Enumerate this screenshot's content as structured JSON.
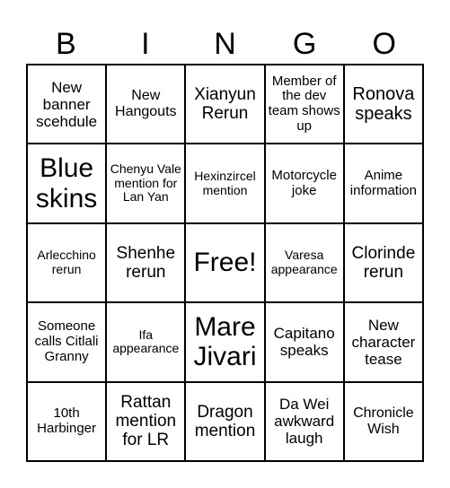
{
  "header": {
    "letters": [
      "B",
      "I",
      "N",
      "G",
      "O"
    ]
  },
  "board": {
    "cells": [
      [
        "New banner scehdule",
        "New Hangouts",
        "Xianyun Rerun",
        "Member of the dev team shows up",
        "Ronova speaks"
      ],
      [
        "Blue skins",
        "Chenyu Vale mention for Lan Yan",
        "Hexinzircel mention",
        "Motorcycle joke",
        "Anime information"
      ],
      [
        "Arlecchino rerun",
        "Shenhe rerun",
        "Free!",
        "Varesa appearance",
        "Clorinde rerun"
      ],
      [
        "Someone calls Citlali Granny",
        "Ifa appearance",
        "Mare Jivari",
        "Capitano speaks",
        "New character tease"
      ],
      [
        "10th Harbinger",
        "Rattan mention for LR",
        "Dragon mention",
        "Da Wei awkward laugh",
        "Chronicle Wish"
      ]
    ]
  }
}
